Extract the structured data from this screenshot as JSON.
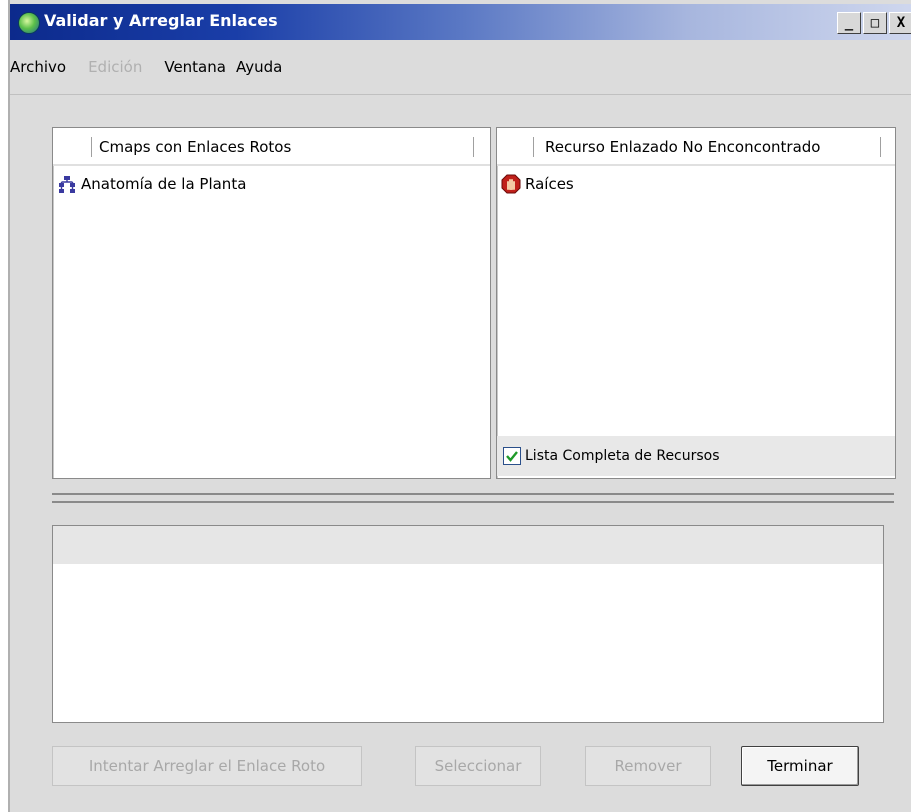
{
  "window": {
    "title": "Validar y Arreglar Enlaces",
    "controls": {
      "minimize": "_",
      "maximize": "□",
      "close": "X"
    }
  },
  "menu": {
    "items": [
      {
        "label": "Archivo",
        "enabled": true
      },
      {
        "label": "Edición",
        "enabled": false
      },
      {
        "label": "Ventana",
        "enabled": true
      },
      {
        "label": "Ayuda",
        "enabled": true
      }
    ]
  },
  "left_panel": {
    "header": "Cmaps con Enlaces Rotos",
    "rows": [
      {
        "icon": "cmap-icon",
        "label": "Anatomía de la Planta"
      }
    ]
  },
  "right_panel": {
    "header": "Recurso Enlazado No Enconcontrado",
    "rows": [
      {
        "icon": "stop-icon",
        "label": "Raíces"
      }
    ],
    "checkbox": {
      "label": "Lista Completa de Recursos",
      "checked": true
    }
  },
  "buttons": {
    "fix": {
      "label": "Intentar Arreglar el Enlace Roto",
      "enabled": false
    },
    "select": {
      "label": "Seleccionar",
      "enabled": false
    },
    "remove": {
      "label": "Remover",
      "enabled": false
    },
    "finish": {
      "label": "Terminar",
      "enabled": true
    }
  }
}
